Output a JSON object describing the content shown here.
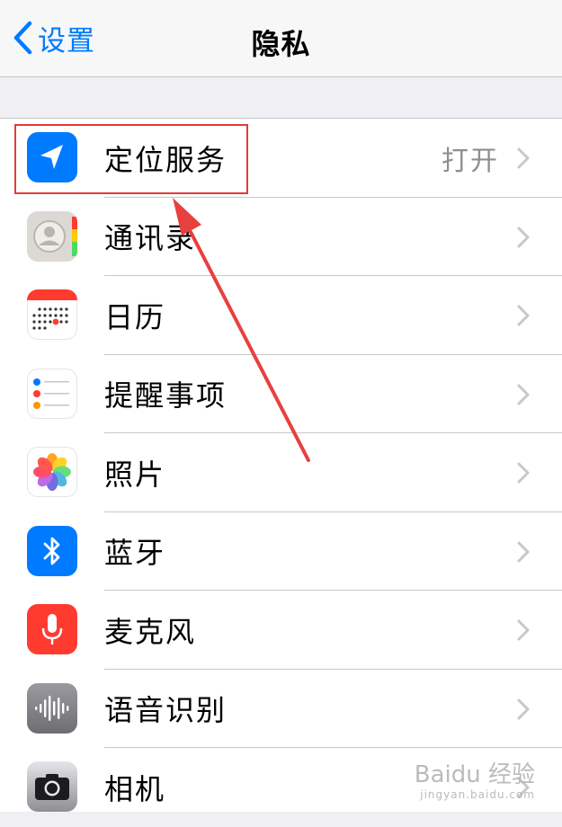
{
  "navbar": {
    "back_label": "设置",
    "title": "隐私"
  },
  "rows": [
    {
      "label": "定位服务",
      "value": "打开",
      "icon": "location-arrow-icon",
      "color": "#007aff"
    },
    {
      "label": "通讯录",
      "value": "",
      "icon": "contacts-icon",
      "color": "#d9d6d2"
    },
    {
      "label": "日历",
      "value": "",
      "icon": "calendar-icon",
      "color": "#ffffff"
    },
    {
      "label": "提醒事项",
      "value": "",
      "icon": "reminders-icon",
      "color": "#ffffff"
    },
    {
      "label": "照片",
      "value": "",
      "icon": "photos-icon",
      "color": "#ffffff"
    },
    {
      "label": "蓝牙",
      "value": "",
      "icon": "bluetooth-icon",
      "color": "#007aff"
    },
    {
      "label": "麦克风",
      "value": "",
      "icon": "microphone-icon",
      "color": "#ff3b30"
    },
    {
      "label": "语音识别",
      "value": "",
      "icon": "speech-recognition-icon",
      "color": "#8e8e93"
    },
    {
      "label": "相机",
      "value": "",
      "icon": "camera-icon",
      "color": "#8e8e93"
    }
  ],
  "watermark": {
    "main": "Baidu 经验",
    "sub": "jingyan.baidu.com"
  }
}
